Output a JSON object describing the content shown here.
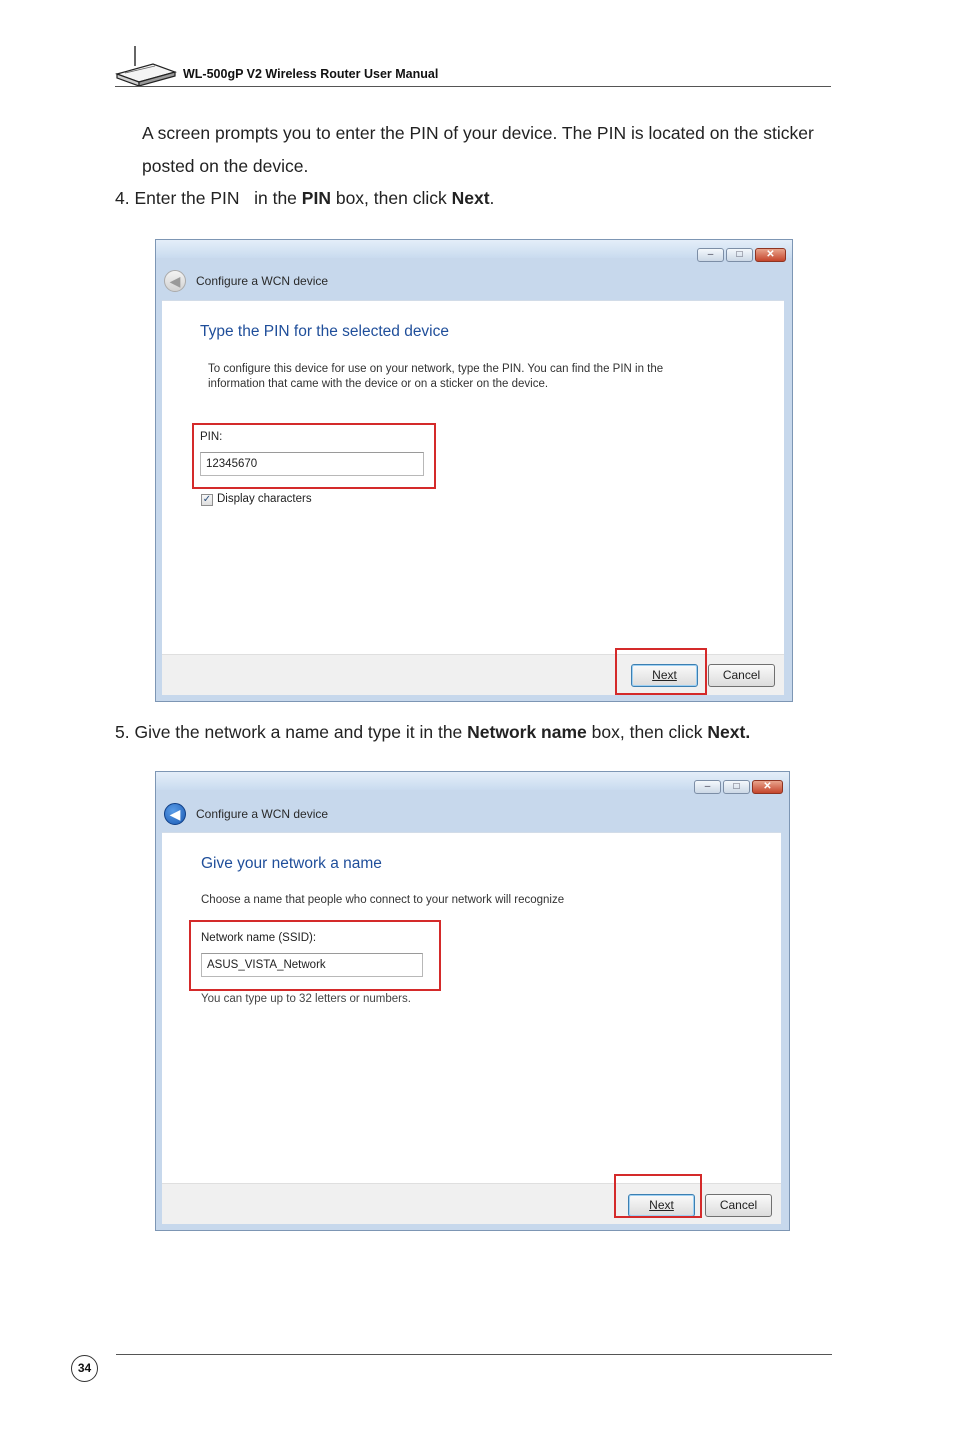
{
  "header": {
    "manual_title": "WL-500gP V2 Wireless Router User Manual",
    "logo_icon": "router-icon"
  },
  "intro": {
    "line1": "A screen prompts you to enter the PIN of your device. The PIN is located on the sticker",
    "line2": "posted on the device."
  },
  "step4": {
    "prefix": "4. Enter the PIN   in the ",
    "bold1": "PIN",
    "middle": " box, then click ",
    "bold2": "Next",
    "suffix": "."
  },
  "step5": {
    "prefix": "5. Give the network a name and type it in the ",
    "bold1": "Network name",
    "middle": " box, then click ",
    "bold2": "Next."
  },
  "window1": {
    "title": "Configure a WCN device",
    "heading": "Type the PIN for the selected device",
    "desc_line1": "To configure this device for use on your network, type the PIN. You can find the PIN in the",
    "desc_line2": "information that came with the device or on a sticker on the device.",
    "pin_label": "PIN:",
    "pin_value": "12345670",
    "checkbox_label": "Display characters",
    "checkbox_checked": true,
    "next_label": "Next",
    "cancel_label": "Cancel",
    "back_icon": "back-arrow-icon",
    "back_enabled": false
  },
  "window2": {
    "title": "Configure a WCN device",
    "heading": "Give your network a name",
    "desc": "Choose a name that people who connect to your network will recognize",
    "ssid_label": "Network name (SSID):",
    "ssid_value": "ASUS_VISTA_Network",
    "hint": "You can type up to 32 letters or numbers.",
    "next_label": "Next",
    "cancel_label": "Cancel",
    "back_icon": "back-arrow-icon",
    "back_enabled": true
  },
  "colors": {
    "highlight": "#d42a2a",
    "heading_blue": "#1f4e9a",
    "window_frame": "#c7d8ec"
  },
  "page_number": "34"
}
